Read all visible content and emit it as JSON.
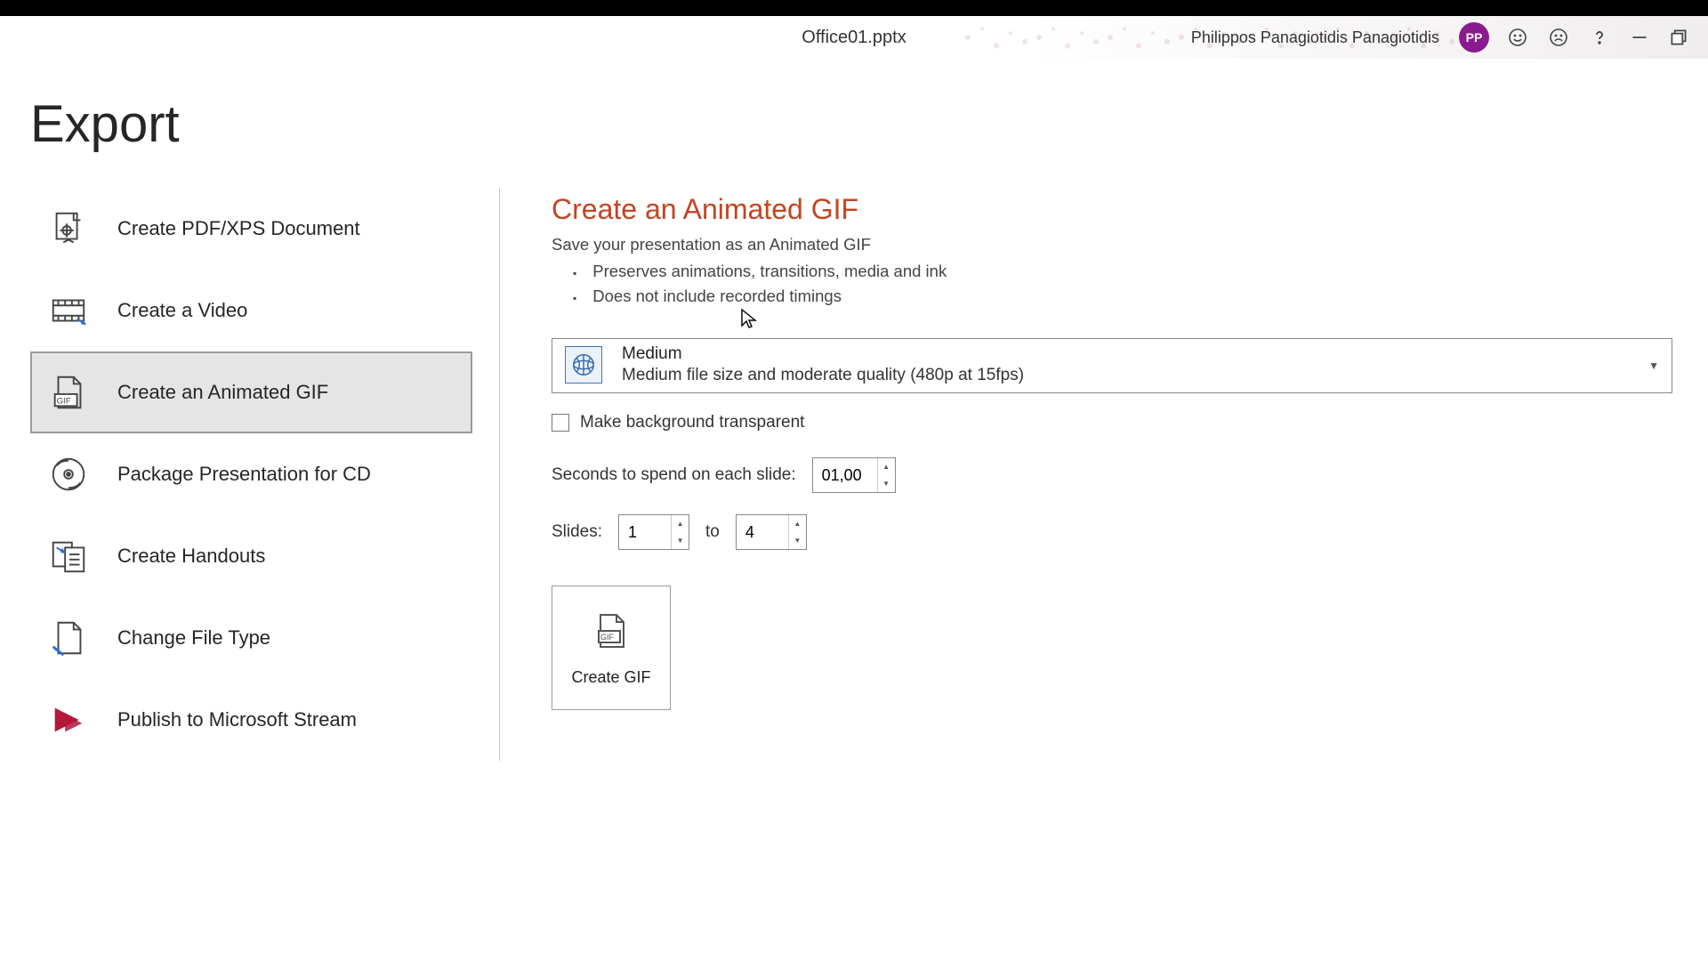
{
  "title_bar": {
    "filename": "Office01.pptx",
    "user_name": "Philippos Panagiotidis Panagiotidis",
    "avatar_initials": "PP"
  },
  "page_title": "Export",
  "sidebar": {
    "items": [
      {
        "label": "Create PDF/XPS Document"
      },
      {
        "label": "Create a Video"
      },
      {
        "label": "Create an Animated GIF"
      },
      {
        "label": "Package Presentation for CD"
      },
      {
        "label": "Create Handouts"
      },
      {
        "label": "Change File Type"
      },
      {
        "label": "Publish to Microsoft Stream"
      }
    ]
  },
  "main": {
    "title": "Create an Animated GIF",
    "subtitle": "Save your presentation as an Animated GIF",
    "bullets": [
      "Preserves animations, transitions, media and ink",
      "Does not include recorded timings"
    ],
    "quality": {
      "selected": "Medium",
      "description": "Medium file size and moderate quality (480p at 15fps)"
    },
    "transparent_label": "Make background transparent",
    "seconds_label": "Seconds to spend on each slide:",
    "seconds_value": "01,00",
    "slides_label": "Slides:",
    "slides_from": "1",
    "slides_to_label": "to",
    "slides_to": "4",
    "create_button": "Create GIF"
  }
}
